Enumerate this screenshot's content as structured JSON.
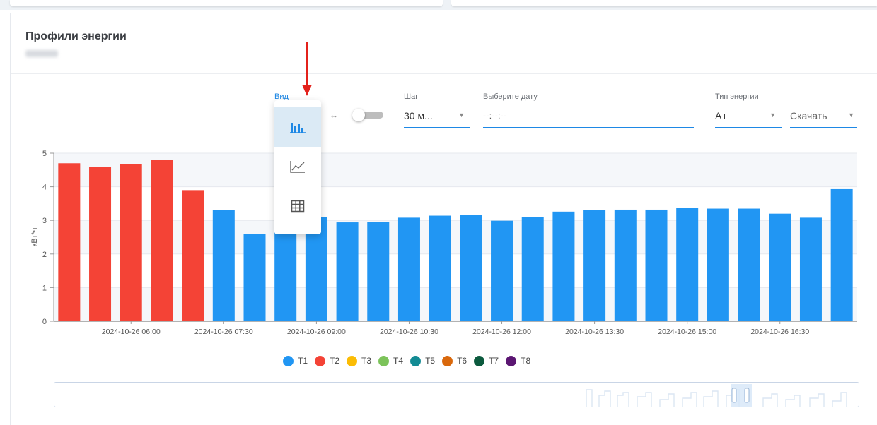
{
  "card": {
    "title": "Профили энергии",
    "subtitle": "07044"
  },
  "controls": {
    "view_label": "Вид",
    "step_label": "Шаг",
    "step_value": "30 м...",
    "date_label": "Выберите дату",
    "date_value": "--:--:--",
    "energy_label": "Тип энергии",
    "energy_value": "A+",
    "download_label": "Скачать",
    "fit_icon": "↔",
    "toggle_on": false
  },
  "view_menu": [
    "bar-chart-icon",
    "line-chart-icon",
    "table-icon"
  ],
  "colors": {
    "T1": "#2196f3",
    "T2": "#f44336",
    "accent": "#1e88e5",
    "arrow": "#e3211b"
  },
  "chart_data": {
    "type": "bar",
    "ylabel": "кВт*ч",
    "ylim": [
      0,
      5
    ],
    "yticks": [
      0,
      1,
      2,
      3,
      4,
      5
    ],
    "xtick_labels": [
      "2024-10-26 06:00",
      "2024-10-26 07:30",
      "2024-10-26 09:00",
      "2024-10-26 10:30",
      "2024-10-26 12:00",
      "2024-10-26 13:30",
      "2024-10-26 15:00",
      "2024-10-26 16:30"
    ],
    "values": [
      4.7,
      4.6,
      4.68,
      4.8,
      3.9,
      3.3,
      2.6,
      3.1,
      3.1,
      2.94,
      2.96,
      3.08,
      3.14,
      3.16,
      2.99,
      3.1,
      3.26,
      3.3,
      3.32,
      3.32,
      3.37,
      3.35,
      3.35,
      3.2,
      3.08,
      3.93
    ],
    "tariffs": [
      "T2",
      "T2",
      "T2",
      "T2",
      "T2",
      "T1",
      "T1",
      "T1",
      "T1",
      "T1",
      "T1",
      "T1",
      "T1",
      "T1",
      "T1",
      "T1",
      "T1",
      "T1",
      "T1",
      "T1",
      "T1",
      "T1",
      "T1",
      "T1",
      "T1",
      "T1"
    ],
    "legend": [
      {
        "name": "T1",
        "color": "#2196f3"
      },
      {
        "name": "T2",
        "color": "#f44336"
      },
      {
        "name": "T3",
        "color": "#fbbc05"
      },
      {
        "name": "T4",
        "color": "#7cc35a"
      },
      {
        "name": "T5",
        "color": "#138b94"
      },
      {
        "name": "T6",
        "color": "#d9680c"
      },
      {
        "name": "T7",
        "color": "#0c5a3e"
      },
      {
        "name": "T8",
        "color": "#5b1672"
      }
    ]
  }
}
